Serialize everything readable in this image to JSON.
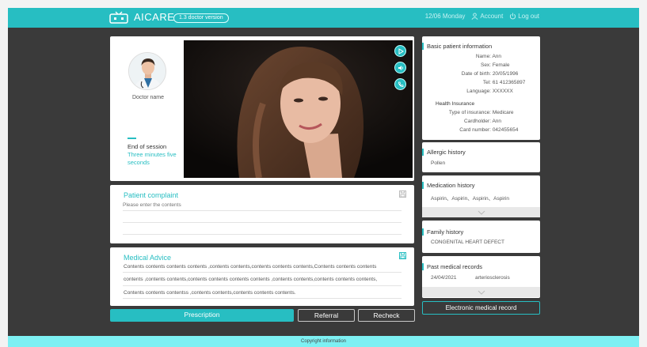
{
  "header": {
    "brand": "AICARE",
    "version": "1.3 doctor version",
    "date": "12/06 Monday",
    "account": "Account",
    "logout": "Log out"
  },
  "session": {
    "doctor_name": "Doctor name",
    "end_label": "End of session",
    "time_remaining": "Three minutes five seconds"
  },
  "complaint": {
    "title": "Patient complaint",
    "placeholder": "Please enter the contents"
  },
  "advice": {
    "title": "Medical Advice",
    "lines": [
      "Contents contents contents    contents ,contents contents,contents contents contents,Contents contents contents",
      "contents ,contents contents,contents contents contents    contents ,contents contents,contents contents contents,",
      "Contents contents contentss ,contents contents,contents contents contents."
    ]
  },
  "actions": {
    "prescription": "Prescription",
    "referral": "Referral",
    "recheck": "Recheck"
  },
  "basic_info": {
    "title": "Basic patient information",
    "fields": [
      {
        "label": "Name:",
        "value": "Ann"
      },
      {
        "label": "Sex:",
        "value": "Female"
      },
      {
        "label": "Date of birth:",
        "value": "20/05/1996"
      },
      {
        "label": "Tel:",
        "value": "61 412365897"
      },
      {
        "label": "Language:",
        "value": "XXXXXX"
      }
    ],
    "insurance_title": "Health Insurance",
    "insurance": [
      {
        "label": "Type of insurance:",
        "value": "Medicare"
      },
      {
        "label": "Cardholder:",
        "value": "Ann"
      },
      {
        "label": "Card number:",
        "value": "042455654"
      }
    ]
  },
  "allergic": {
    "title": "Allergic history",
    "text": "Pollen"
  },
  "medication": {
    "title": "Medication history",
    "text": "Aspirin、Aspirin、Aspirin、Aspirin"
  },
  "family": {
    "title": "Family history",
    "text": "CONGENITAL HEART DEFECT"
  },
  "past_records": {
    "title": "Past medical records",
    "date": "24/04/2021",
    "diagnosis": "arteriosclerosis"
  },
  "emr_button": "Electronic medical record",
  "footer": "Copyright information",
  "colors": {
    "accent": "#27bec2",
    "background": "#3a3a3a",
    "footer": "#7df0f3"
  }
}
